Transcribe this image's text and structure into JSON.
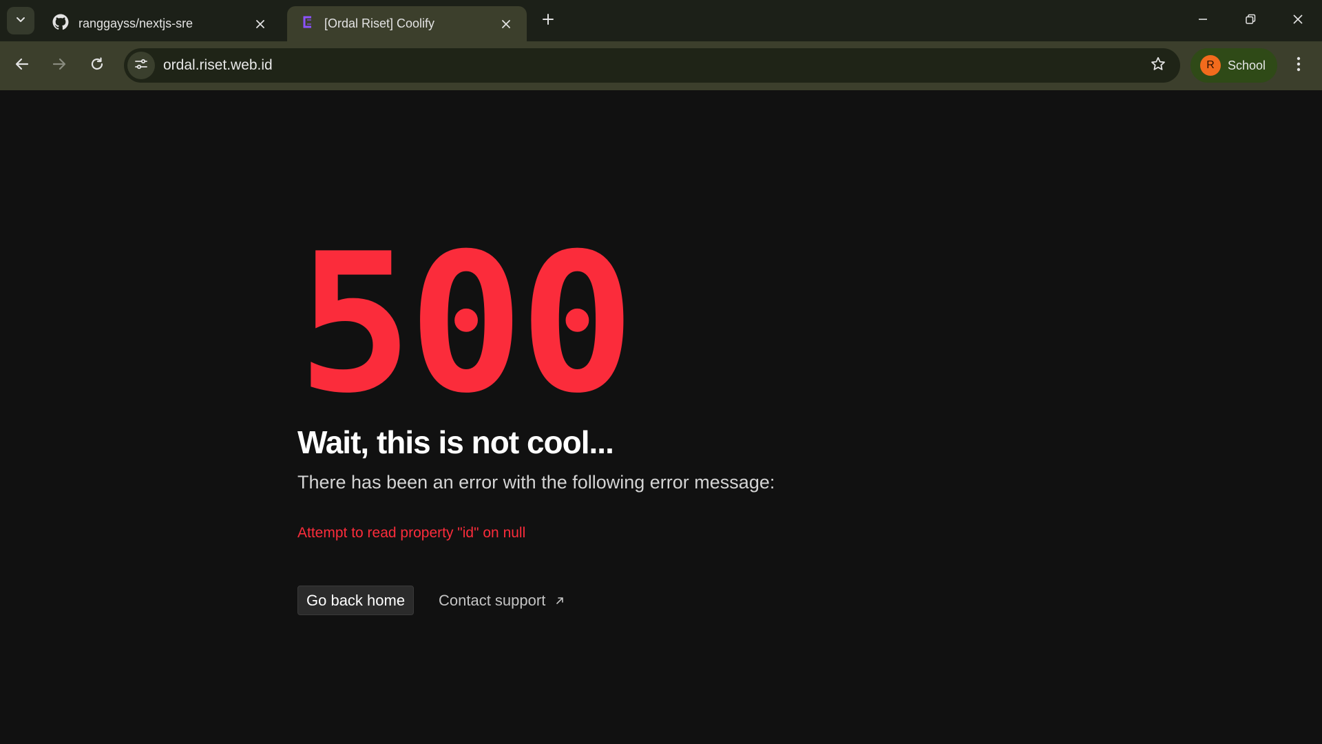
{
  "browser": {
    "tabs": [
      {
        "title": "ranggayss/nextjs-sre",
        "icon": "github-icon",
        "active": false
      },
      {
        "title": "[Ordal Riset] Coolify",
        "icon": "coolify-icon",
        "active": true
      }
    ],
    "address_bar": {
      "url": "ordal.riset.web.id"
    },
    "profile": {
      "initial": "R",
      "label": "School"
    },
    "colors": {
      "tabstrip_bg": "#1c2018",
      "toolbar_bg": "#3c3f2c",
      "omnibox_bg": "#1f2417",
      "profile_chip_bg": "#2f4a17",
      "avatar_bg": "#f26b1d"
    }
  },
  "page": {
    "error_code": "500",
    "headline": "Wait, this is not cool...",
    "subtext": "There has been an error with the following error message:",
    "error_message": "Attempt to read property \"id\" on null",
    "home_button_label": "Go back home",
    "support_link_label": "Contact support",
    "colors": {
      "background": "#111111",
      "accent_red": "#fb2c3b",
      "text": "#ffffff"
    }
  }
}
